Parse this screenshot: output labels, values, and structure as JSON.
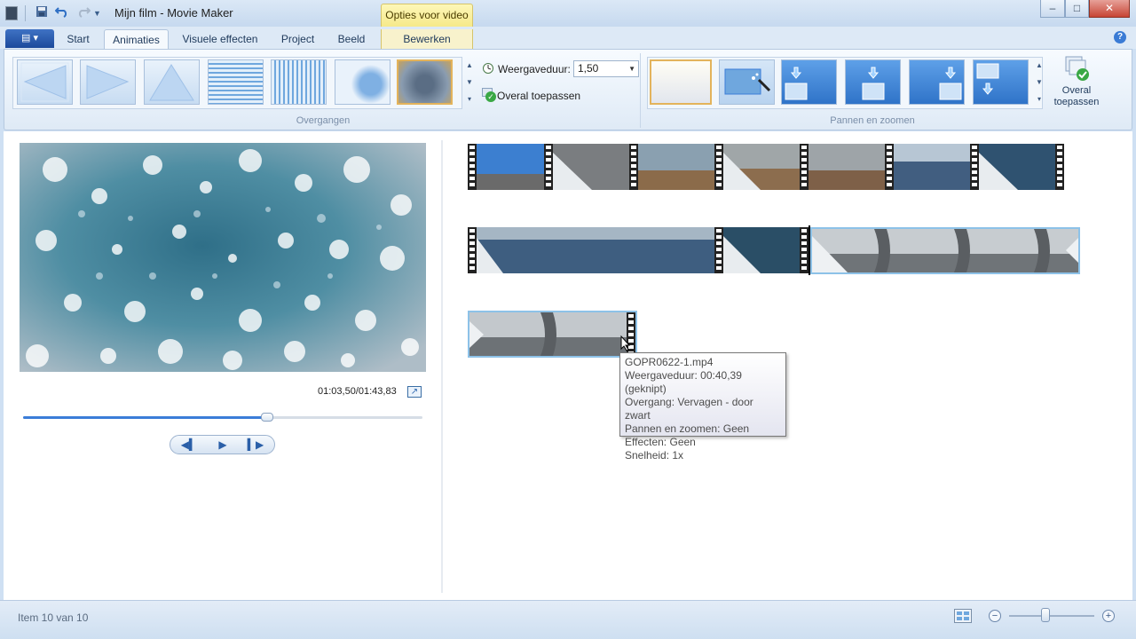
{
  "window": {
    "title": "Mijn film - Movie Maker",
    "contextual_header": "Opties voor video",
    "controls": {
      "minimize": "–",
      "maximize": "□",
      "close": "✕"
    }
  },
  "quick_access": {
    "save_icon": "save-icon",
    "undo_icon": "undo-icon",
    "redo_icon": "redo-icon",
    "customize_icon": "dropdown-icon"
  },
  "tabs": {
    "file_button": "▤ ▾",
    "items": [
      {
        "label": "Start"
      },
      {
        "label": "Animaties"
      },
      {
        "label": "Visuele effecten"
      },
      {
        "label": "Project"
      },
      {
        "label": "Beeld"
      },
      {
        "label": "Bewerken"
      }
    ],
    "active": "Animaties"
  },
  "ribbon": {
    "transitions": {
      "group_label": "Overgangen",
      "duration_label": "Weergaveduur:",
      "duration_value": "1,50",
      "apply_all_label": "Overal toepassen"
    },
    "pan_zoom": {
      "group_label": "Pannen en zoomen",
      "apply_all_big_label": "Overal toepassen"
    }
  },
  "player": {
    "timecode": "01:03,50/01:43,83",
    "progress_fraction": 0.61
  },
  "tooltip": {
    "lines": [
      "GOPR0622-1.mp4",
      "Weergaveduur: 00:40,39 (geknipt)",
      "Overgang: Vervagen - door zwart",
      "Pannen en zoomen: Geen",
      "Effecten: Geen",
      "Snelheid: 1x"
    ]
  },
  "statusbar": {
    "item_text": "Item 10 van 10",
    "zoom_minus": "−",
    "zoom_plus": "+"
  },
  "colors": {
    "accent_blue": "#3b7dd8",
    "selection_gold": "#e3b35b",
    "context_yellow": "#f6e98a",
    "selected_clip_border": "#8dc2e8"
  }
}
